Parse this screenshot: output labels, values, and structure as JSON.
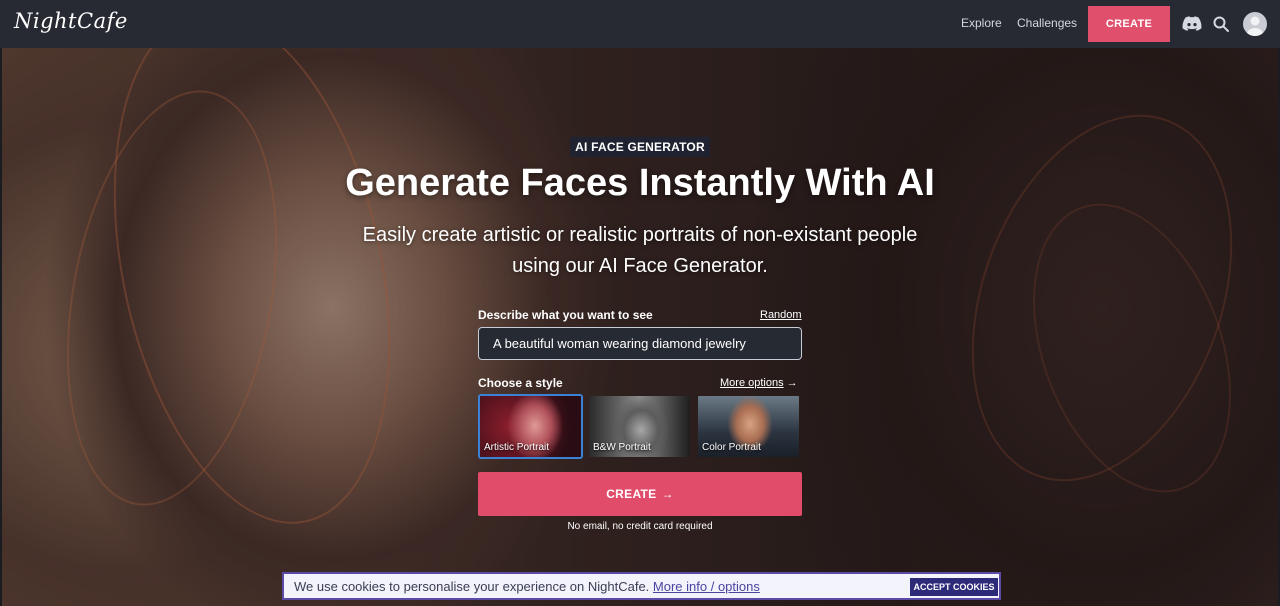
{
  "nav": {
    "logo": "NightCafe",
    "explore": "Explore",
    "challenges": "Challenges",
    "create": "CREATE",
    "icons": [
      "discord-icon",
      "search-icon",
      "avatar"
    ],
    "accent_color": "#e0506c"
  },
  "hero": {
    "badge": "AI FACE GENERATOR",
    "title": "Generate Faces Instantly With AI",
    "subtitle": "Easily create artistic or realistic portraits of non-existant people using our AI Face Generator.",
    "describe_label": "Describe what you want to see",
    "random": "Random",
    "prompt_value": "A beautiful woman wearing diamond jewelry",
    "style_label": "Choose a style",
    "more_options": "More options",
    "more_arrow": "→",
    "styles": [
      {
        "label": "Artistic Portrait",
        "selected": true
      },
      {
        "label": "B&W Portrait",
        "selected": false
      },
      {
        "label": "Color Portrait",
        "selected": false
      }
    ],
    "create_button": "CREATE",
    "create_arrow": "→",
    "no_email": "No email, no credit card required"
  },
  "cookie": {
    "text": "We use cookies to personalise your experience on NightCafe.",
    "link": "More info / options",
    "accept": "ACCEPT COOKIES"
  }
}
